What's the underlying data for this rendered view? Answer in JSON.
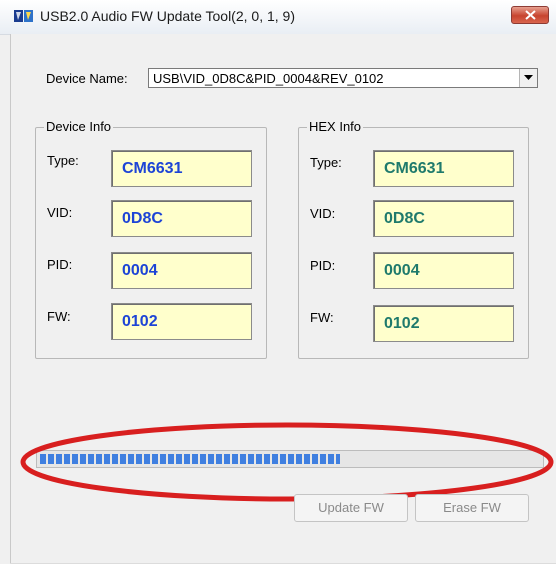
{
  "window": {
    "title": "USB2.0 Audio FW Update Tool(2, 0, 1, 9)"
  },
  "device_name": {
    "label": "Device Name:",
    "value": "USB\\VID_0D8C&PID_0004&REV_0102"
  },
  "device_info": {
    "title": "Device Info",
    "fields": [
      {
        "label": "Type:",
        "value": "CM6631"
      },
      {
        "label": "VID:",
        "value": "0D8C"
      },
      {
        "label": "PID:",
        "value": "0004"
      },
      {
        "label": "FW:",
        "value": "0102"
      }
    ]
  },
  "hex_info": {
    "title": "HEX Info",
    "fields": [
      {
        "label": "Type:",
        "value": "CM6631"
      },
      {
        "label": "VID:",
        "value": "0D8C"
      },
      {
        "label": "PID:",
        "value": "0004"
      },
      {
        "label": "FW:",
        "value": "0102"
      }
    ]
  },
  "progress": {
    "fraction": 0.6
  },
  "buttons": {
    "update_fw": "Update FW",
    "erase_fw": "Erase FW"
  },
  "colors": {
    "field_background": "#ffffcc",
    "device_value_text": "#1d44d6",
    "hex_value_text": "#1f7a6c",
    "progress_fill": "#3f7fe0",
    "highlight_ellipse": "#d81f1f"
  },
  "icons": {
    "app": "app-logo-icon",
    "close": "close-icon",
    "dropdown": "chevron-down-icon"
  }
}
